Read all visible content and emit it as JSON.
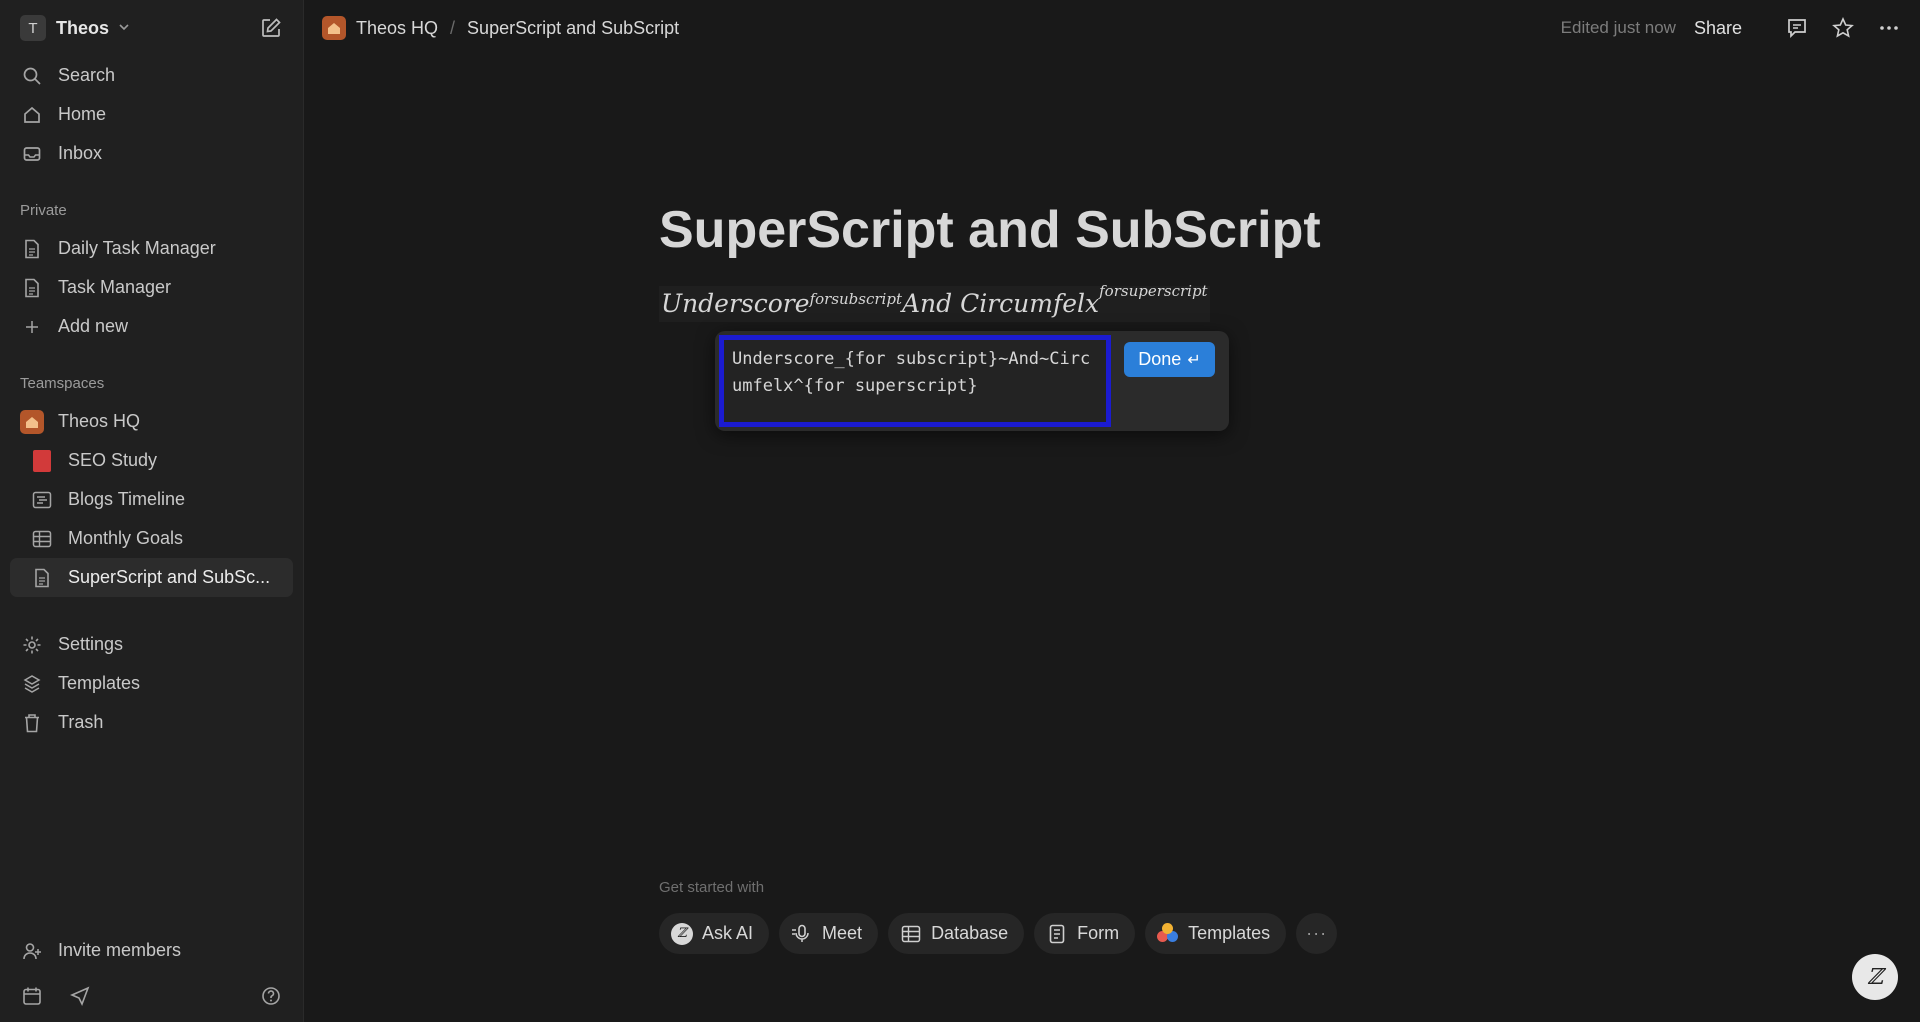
{
  "workspace": {
    "initial": "T",
    "name": "Theos"
  },
  "nav": {
    "search": "Search",
    "home": "Home",
    "inbox": "Inbox"
  },
  "private": {
    "label": "Private",
    "items": [
      "Daily Task Manager",
      "Task Manager"
    ],
    "add_new": "Add new"
  },
  "teamspaces": {
    "label": "Teamspaces",
    "team_name": "Theos HQ",
    "items": [
      "SEO Study",
      "Blogs Timeline",
      "Monthly Goals",
      "SuperScript and SubSc..."
    ]
  },
  "utility": {
    "settings": "Settings",
    "templates": "Templates",
    "trash": "Trash"
  },
  "invite": "Invite members",
  "breadcrumb": {
    "teamspace": "Theos HQ",
    "page": "SuperScript and SubScript"
  },
  "topbar": {
    "edited": "Edited just now",
    "share": "Share"
  },
  "page": {
    "title": "SuperScript and SubScript"
  },
  "equation": {
    "base1": "Underscore",
    "sub": "forsubscript",
    "base2": " And Circumfelx",
    "sup": "forsuperscript",
    "source_text": "Underscore_{for subscript}~And~Circumfelx^{for superscript}",
    "done_label": "Done",
    "done_icon": "↵"
  },
  "get_started": {
    "label": "Get started with",
    "chips": [
      "Ask AI",
      "Meet",
      "Database",
      "Form",
      "Templates"
    ]
  },
  "icons": {
    "ai_glyph": "ℤ",
    "help_glyph": "ℤ",
    "more": "···",
    "chevron": "⌄"
  },
  "colors": {
    "accent_blue": "#2b7fd9",
    "input_outline": "#1b1bd0",
    "teamspace_orange": "#b3562a",
    "seo_red": "#d23a3a"
  }
}
